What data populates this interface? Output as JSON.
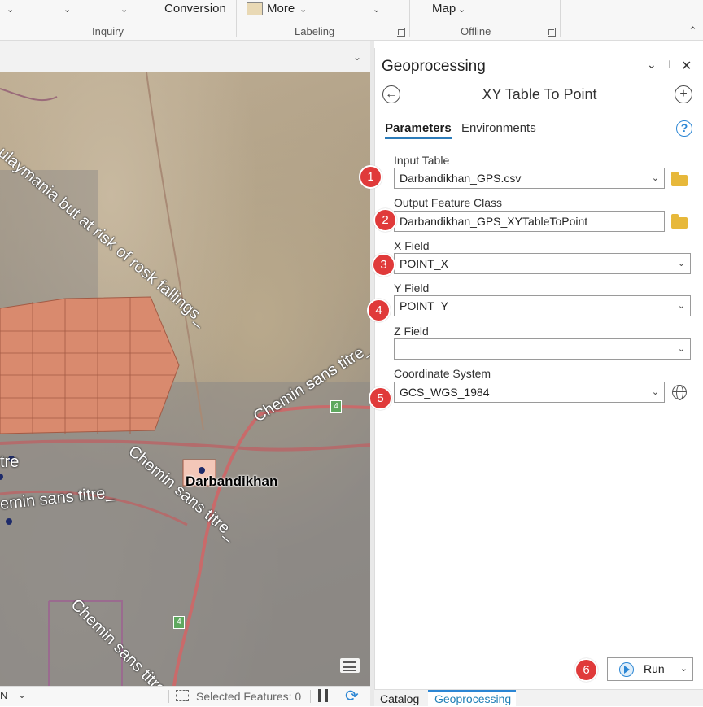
{
  "ribbon": {
    "items": {
      "conversion": "Conversion",
      "more": "More",
      "map": "Map"
    },
    "groups": {
      "inquiry": "Inquiry",
      "labeling": "Labeling",
      "offline": "Offline"
    }
  },
  "map": {
    "labels": {
      "sulaymania": "ulaymania but at risk of rosk fallings_",
      "chemin_1": "Chemin sans titre_",
      "chemin_2": "Chemin sans titre_",
      "chemin_3": "Chemin sans titre_",
      "chemin_4": "emin sans titre_",
      "chemin_5": "Chemin sans titre_",
      "tre": "tre"
    },
    "place": "Darbandikhan",
    "road_shield": "4"
  },
  "status": {
    "selected_features": "Selected Features: 0"
  },
  "geoprocessing": {
    "title": "Geoprocessing",
    "tool_title": "XY Table To Point",
    "tabs": {
      "parameters": "Parameters",
      "environments": "Environments"
    },
    "help": "?",
    "params": [
      {
        "badge": "1",
        "label": "Input Table",
        "value": "Darbandikhan_GPS.csv"
      },
      {
        "badge": "2",
        "label": "Output Feature Class",
        "value": "Darbandikhan_GPS_XYTableToPoint"
      },
      {
        "badge": "3",
        "label": "X Field",
        "value": "POINT_X"
      },
      {
        "badge": "4",
        "label": "Y Field",
        "value": "POINT_Y"
      },
      {
        "badge": "",
        "label": "Z Field",
        "value": ""
      },
      {
        "badge": "5",
        "label": "Coordinate System",
        "value": "GCS_WGS_1984"
      }
    ],
    "run": {
      "badge": "6",
      "label": "Run"
    }
  },
  "bottom_tabs": {
    "catalog": "Catalog",
    "geoprocessing": "Geoprocessing"
  },
  "colors": {
    "accent": "#2b86d4",
    "badge": "#e03a3a",
    "parcel": "#d98a6e"
  }
}
